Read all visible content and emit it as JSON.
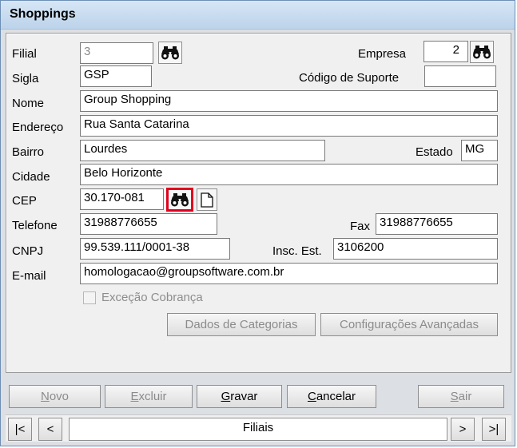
{
  "window": {
    "title": "Shoppings"
  },
  "form": {
    "filial": {
      "label": "Filial",
      "value": "3"
    },
    "empresa": {
      "label": "Empresa",
      "value": "2"
    },
    "sigla": {
      "label": "Sigla",
      "value": "GSP"
    },
    "codigo_suporte": {
      "label": "Código de Suporte",
      "value": ""
    },
    "nome": {
      "label": "Nome",
      "value": "Group Shopping"
    },
    "endereco": {
      "label": "Endereço",
      "value": "Rua Santa Catarina"
    },
    "bairro": {
      "label": "Bairro",
      "value": "Lourdes"
    },
    "estado": {
      "label": "Estado",
      "value": "MG"
    },
    "cidade": {
      "label": "Cidade",
      "value": "Belo Horizonte"
    },
    "cep": {
      "label": "CEP",
      "value": "30.170-081"
    },
    "telefone": {
      "label": "Telefone",
      "value": "31988776655"
    },
    "fax": {
      "label": "Fax",
      "value": "31988776655"
    },
    "cnpj": {
      "label": "CNPJ",
      "value": "99.539.111/0001-38"
    },
    "insc_est": {
      "label": "Insc. Est.",
      "value": "3106200"
    },
    "email": {
      "label": "E-mail",
      "value": "homologacao@groupsoftware.com.br"
    },
    "excecao_cobranca": {
      "label": "Exceção Cobrança",
      "checked": false
    }
  },
  "buttons": {
    "dados_categorias": "Dados de Categorias",
    "configuracoes": "Configurações Avançadas"
  },
  "actions": {
    "novo": {
      "first": "N",
      "rest": "ovo"
    },
    "excluir": {
      "first": "E",
      "rest": "xcluir"
    },
    "gravar": {
      "first": "G",
      "rest": "ravar"
    },
    "cancelar": {
      "first": "C",
      "rest": "ancelar"
    },
    "sair": {
      "first": "S",
      "rest": "air"
    }
  },
  "nav": {
    "first": "|<",
    "prev": "<",
    "label": "Filiais",
    "next": ">",
    "last": ">|"
  },
  "colors": {
    "highlight": "#e0001e",
    "titlebar": "#bcd3ea"
  },
  "icons": {
    "search": "binoculars-icon",
    "new": "new-document-icon"
  }
}
